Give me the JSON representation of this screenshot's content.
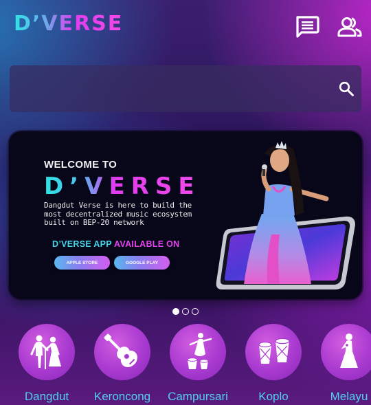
{
  "header": {
    "logo_text": "D’VERSE",
    "messages_icon": "chat-message-icon",
    "account_icon": "users-icon"
  },
  "search": {
    "value": "",
    "placeholder": "",
    "icon": "search-icon"
  },
  "banner": {
    "welcome": "WELCOME TO",
    "brand": "D’VERSE",
    "description": "Dangdut Verse is here to build the most decentralized music ecosystem built on BEP-20 network",
    "availability_app": "D’VERSE APP",
    "availability_on": "AVAILABLE ON",
    "apple_store": "APPLE STORE",
    "google_play": "GOOGLE PLAY"
  },
  "carousel": {
    "total_pages": 3,
    "active_page": 1
  },
  "categories": [
    {
      "label": "Dangdut",
      "icon": "dancing-couple-icon"
    },
    {
      "label": "Keroncong",
      "icon": "ukulele-icon"
    },
    {
      "label": "Campursari",
      "icon": "dancer-with-drums-icon"
    },
    {
      "label": "Koplo",
      "icon": "drums-icon"
    },
    {
      "label": "Melayu",
      "icon": "singer-woman-icon"
    }
  ],
  "colors": {
    "accent_cyan": "#43d6ea",
    "accent_magenta": "#e542f0",
    "category_label": "#4fd2ef"
  }
}
